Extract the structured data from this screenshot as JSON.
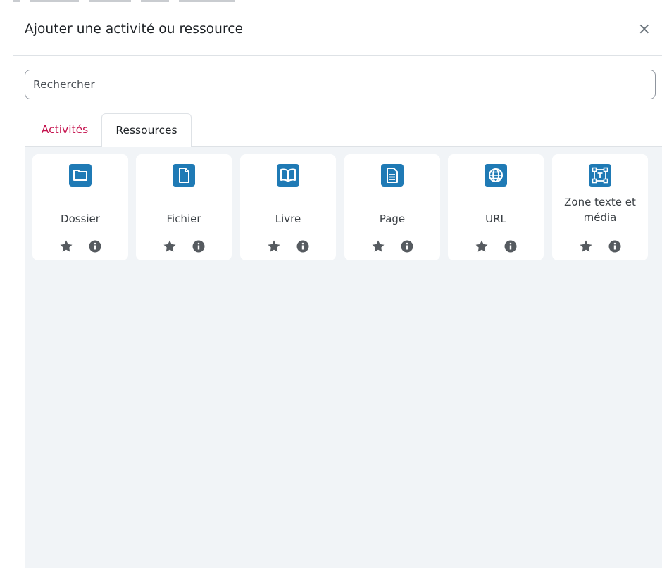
{
  "modal": {
    "title": "Ajouter une activité ou ressource",
    "close_label": "×"
  },
  "search": {
    "placeholder": "Rechercher",
    "value": ""
  },
  "tabs": [
    {
      "label": "Activités",
      "active": false
    },
    {
      "label": "Ressources",
      "active": true
    }
  ],
  "items": [
    {
      "label": "Dossier",
      "icon": "folder-icon"
    },
    {
      "label": "Fichier",
      "icon": "file-icon"
    },
    {
      "label": "Livre",
      "icon": "book-icon"
    },
    {
      "label": "Page",
      "icon": "page-icon"
    },
    {
      "label": "URL",
      "icon": "globe-icon"
    },
    {
      "label": "Zone texte et média",
      "icon": "text-media-icon"
    }
  ],
  "colors": {
    "accent": "#c4104c",
    "icon_blue": "#1f7ab5",
    "panel_bg": "#f1f4f7",
    "action_icon": "#565b60"
  }
}
